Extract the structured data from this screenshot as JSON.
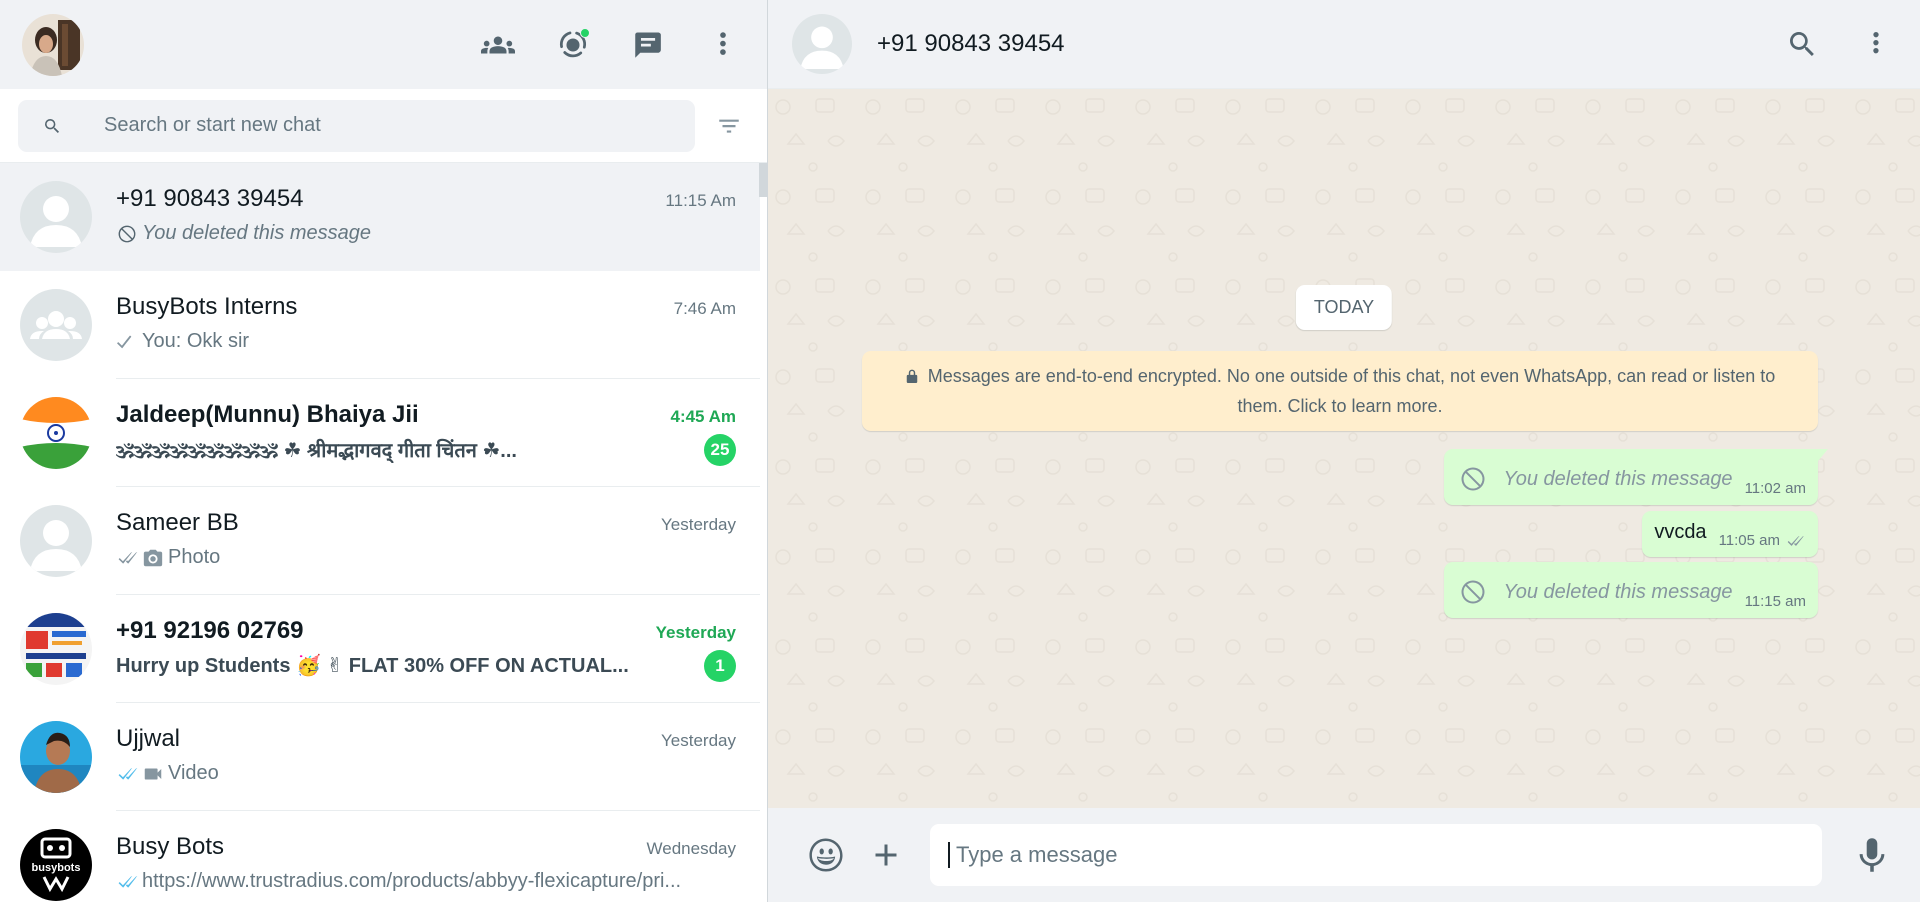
{
  "left_header": {
    "icons": [
      "communities-icon",
      "status-icon",
      "new-chat-icon",
      "menu-icon"
    ]
  },
  "search": {
    "placeholder": "Search or start new chat"
  },
  "chats": [
    {
      "name": "+91 90843 39454",
      "time": "11:15 Am",
      "preview": "You deleted this message",
      "active": true
    },
    {
      "name": "BusyBots Interns",
      "time": "7:46 Am",
      "preview": "You: Okk sir"
    },
    {
      "name": "Jaldeep(Munnu) Bhaiya Jii",
      "time": "4:45 Am",
      "preview": "🕉🕉🕉🕉🕉🕉🕉🕉🕉 ☘ श्रीमद्भागवद् गीता चिंतन ☘...",
      "unread": "25"
    },
    {
      "name": "Sameer BB",
      "time": "Yesterday",
      "preview": "Photo"
    },
    {
      "name": "+91 92196 02769",
      "time": "Yesterday",
      "preview": "Hurry up Students 🥳        ✌ FLAT 30% OFF ON ACTUAL...",
      "unread": "1"
    },
    {
      "name": "Ujjwal",
      "time": "Yesterday",
      "preview": "Video"
    },
    {
      "name": "Busy Bots",
      "time": "Wednesday",
      "preview": "https://www.trustradius.com/products/abbyy-flexicapture/pri..."
    }
  ],
  "conversation": {
    "contact_name": "+91 90843 39454",
    "date_chip": "TODAY",
    "encryption_note": "Messages are end-to-end encrypted. No one outside of this chat, not even WhatsApp, can read or listen to them. Click to learn more.",
    "messages": [
      {
        "type": "deleted",
        "text": "You deleted this message",
        "time": "11:02 am"
      },
      {
        "type": "text",
        "text": "vvcda",
        "time": "11:05 am"
      },
      {
        "type": "deleted",
        "text": "You deleted this message",
        "time": "11:15 am"
      }
    ]
  },
  "composer": {
    "placeholder": "Type a message"
  },
  "busybots_logo_text": "busybots",
  "colors": {
    "accent": "#25d366",
    "unread_time": "#1fa855",
    "outgoing_bubble": "#d9fdd3",
    "encryption_bg": "#ffeecd",
    "read_ticks": "#53bdeb"
  }
}
